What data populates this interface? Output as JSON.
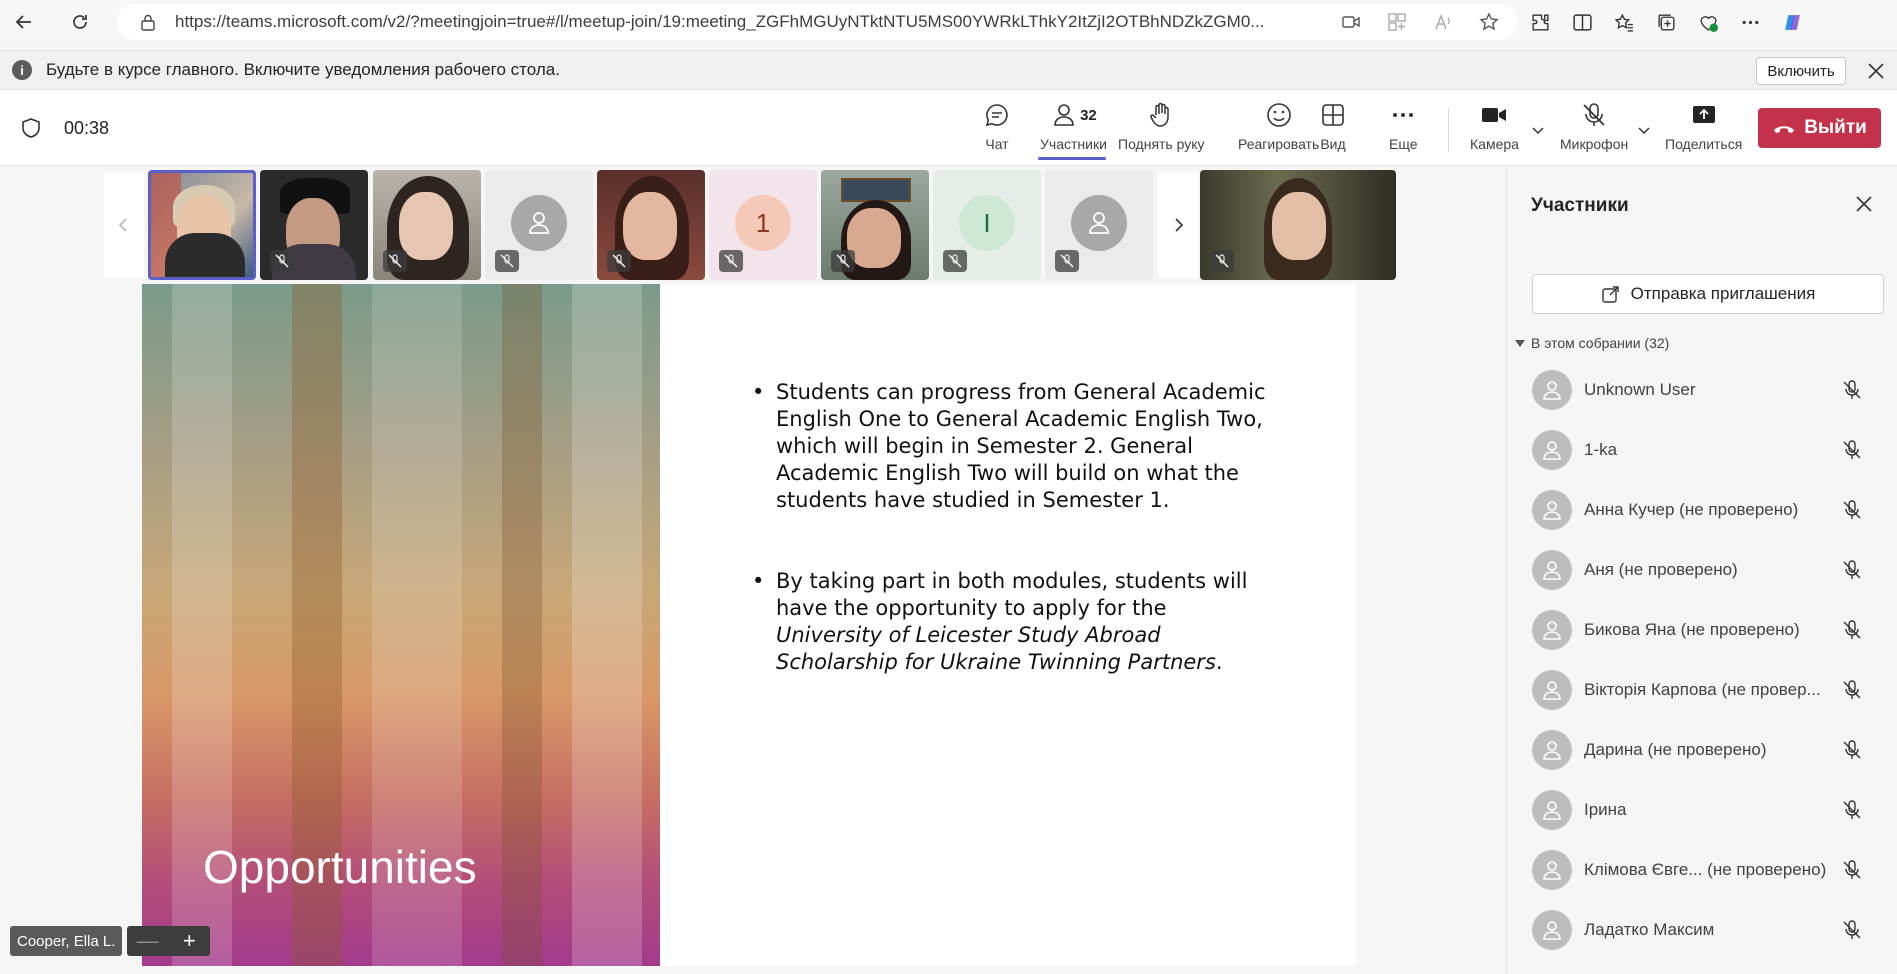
{
  "browser": {
    "url": "https://teams.microsoft.com/v2/?meetingjoin=true#/l/meetup-join/19:meeting_ZGFhMGUyNTktNTU5MS00YWRkLThkY2ItZjI2OTBhNDZkZGM0..."
  },
  "notification": {
    "text": "Будьте в курсе главного. Включите уведомления рабочего стола.",
    "enable_label": "Включить"
  },
  "meeting": {
    "timer": "00:38",
    "toolbar": {
      "chat": "Чат",
      "participants": "Участники",
      "participants_count": "32",
      "raise_hand": "Поднять руку",
      "react": "Реагировать",
      "view": "Вид",
      "more": "Еще",
      "camera": "Камера",
      "mic": "Микрофон",
      "share": "Поделиться",
      "leave": "Выйти"
    },
    "thumbnails": [
      {
        "type": "video",
        "active": true
      },
      {
        "type": "video"
      },
      {
        "type": "video"
      },
      {
        "type": "avatar",
        "initial": ""
      },
      {
        "type": "video"
      },
      {
        "type": "avatar",
        "initial": "1"
      },
      {
        "type": "video"
      },
      {
        "type": "avatar",
        "initial": "I"
      },
      {
        "type": "avatar",
        "initial": ""
      }
    ],
    "presenter_name": "Cooper, Ella L."
  },
  "slide": {
    "title": "Opportunities",
    "bullet1": "Students can progress from General Academic English One to General Academic English Two, which will begin in Semester 2. General Academic English Two will build on what the students have studied in Semester 1.",
    "bullet2_plain": "By taking part in both modules, students will have the opportunity to apply for the ",
    "bullet2_italic": "University of Leicester Study Abroad Scholarship for Ukraine Twinning Partners",
    "bullet2_end": "."
  },
  "panel": {
    "title": "Участники",
    "invite_label": "Отправка приглашения",
    "section_label": "В этом собрании (32)",
    "participants": [
      {
        "name": "Unknown User"
      },
      {
        "name": "1-ka"
      },
      {
        "name": "Анна Кучер (не проверено)"
      },
      {
        "name": "Аня (не проверено)"
      },
      {
        "name": "Бикова Яна (не проверено)"
      },
      {
        "name": "Вікторія Карпова (не провер..."
      },
      {
        "name": "Дарина (не проверено)"
      },
      {
        "name": "Ірина"
      },
      {
        "name": "Клімова Євге...  (не проверено)"
      },
      {
        "name": "Ладатко Максим"
      }
    ]
  },
  "colors": {
    "accent": "#5b5fc7",
    "leave": "#c4314b"
  }
}
